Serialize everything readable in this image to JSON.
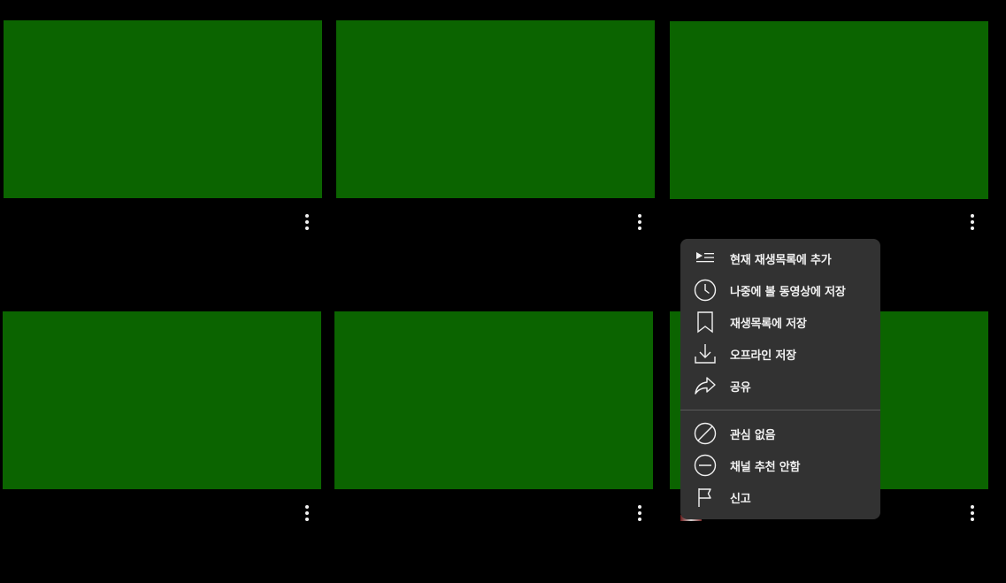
{
  "grid": {
    "videos": [
      {
        "thumb_color": "#0b6400"
      },
      {
        "thumb_color": "#0b6400"
      },
      {
        "thumb_color": "#0b6400"
      },
      {
        "thumb_color": "#0b6400"
      },
      {
        "thumb_color": "#0b6400"
      },
      {
        "thumb_color": "#0b6400"
      }
    ],
    "more_icon": "more-vertical-icon"
  },
  "menu": {
    "items": [
      {
        "label": "현재 재생목록에 추가",
        "icon": "add-to-queue-icon"
      },
      {
        "label": "나중에 볼 동영상에 저장",
        "icon": "clock-icon"
      },
      {
        "label": "재생목록에 저장",
        "icon": "bookmark-icon"
      },
      {
        "label": "오프라인 저장",
        "icon": "download-icon"
      },
      {
        "label": "공유",
        "icon": "share-icon"
      }
    ],
    "secondary_items": [
      {
        "label": "관심 없음",
        "icon": "not-interested-icon"
      },
      {
        "label": "채널 추천 안함",
        "icon": "minus-circle-icon"
      },
      {
        "label": "신고",
        "icon": "flag-icon"
      }
    ]
  }
}
